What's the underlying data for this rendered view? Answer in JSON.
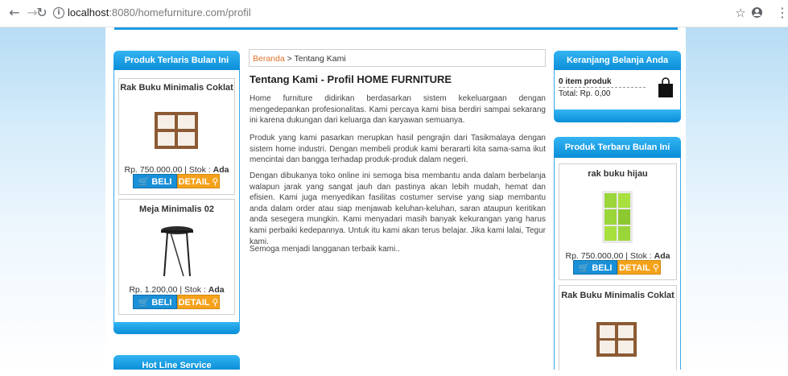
{
  "browser": {
    "url_host": "localhost",
    "url_rest": ":8080/homefurniture.com/profil"
  },
  "breadcrumb": {
    "home": "Beranda",
    "separator": " > ",
    "current": "Tentang Kami"
  },
  "main": {
    "title": "Tentang Kami - Profil HOME FURNITURE",
    "paragraphs": [
      "Home furniture didirikan berdasarkan sistem kekeluargaan dengan mengedepankan profesionalitas. Kami percaya kami bisa berdiri sampai sekarang ini karena dukungan dari keluarga dan karyawan semuanya.",
      "Produk yang kami pasarkan merupkan hasil pengrajin dari Tasikmalaya dengan sistem home industri. Dengan membeli produk kami berararti kita sama-sama ikut mencintai dan bangga terhadap produk-produk dalam negeri.",
      "Dengan dibukanya toko online ini semoga bisa membantu anda dalam berbelanja walapun jarak yang sangat jauh dan pastinya akan lebih mudah, hemat dan efisien. Kami juga menyedikan fasilitas costumer servise yang siap membantu anda dalam order atau siap menjawab keluhan-keluhan, saran ataupun keritikan anda sesegera mungkin. Kami menyadari masih banyak kekurangan yang harus kami perbaiki kedepannya. Untuk itu kami akan terus belajar. Jika kami lalai, Tegur kami.",
      "Semoga menjadi langganan terbaik kami.."
    ]
  },
  "left": {
    "bestseller_title": "Produk Terlaris Bulan Ini",
    "products": [
      {
        "name": "Rak Buku Minimalis Coklat",
        "price": "Rp. 750.000,00 | Stok : ",
        "stock": "Ada"
      },
      {
        "name": "Meja Minimalis 02",
        "price": "Rp. 1.200,00 | Stok : ",
        "stock": "Ada"
      }
    ],
    "hotline_title": "Hot Line Service"
  },
  "right": {
    "cart_title": "Keranjang Belanja Anda",
    "cart_items": "0 item produk",
    "cart_total": "Total: Rp. 0,00",
    "newest_title": "Produk Terbaru Bulan Ini",
    "products": [
      {
        "name": "rak buku hijau",
        "price": "Rp. 750.000,00 | Stok : ",
        "stock": "Ada"
      },
      {
        "name": "Rak Buku Minimalis Coklat"
      }
    ]
  },
  "buttons": {
    "buy": "BELI",
    "detail": "DETAIL"
  },
  "icons": [
    "back-icon",
    "forward-icon",
    "reload-icon",
    "info-icon",
    "star-icon",
    "account-icon",
    "menu-icon",
    "cart-icon",
    "search-icon",
    "shopping-bag-icon"
  ],
  "colors": {
    "accent_blue": "#1e9be0",
    "detail_orange": "#f5a21b",
    "link_orange": "#e0712a"
  }
}
